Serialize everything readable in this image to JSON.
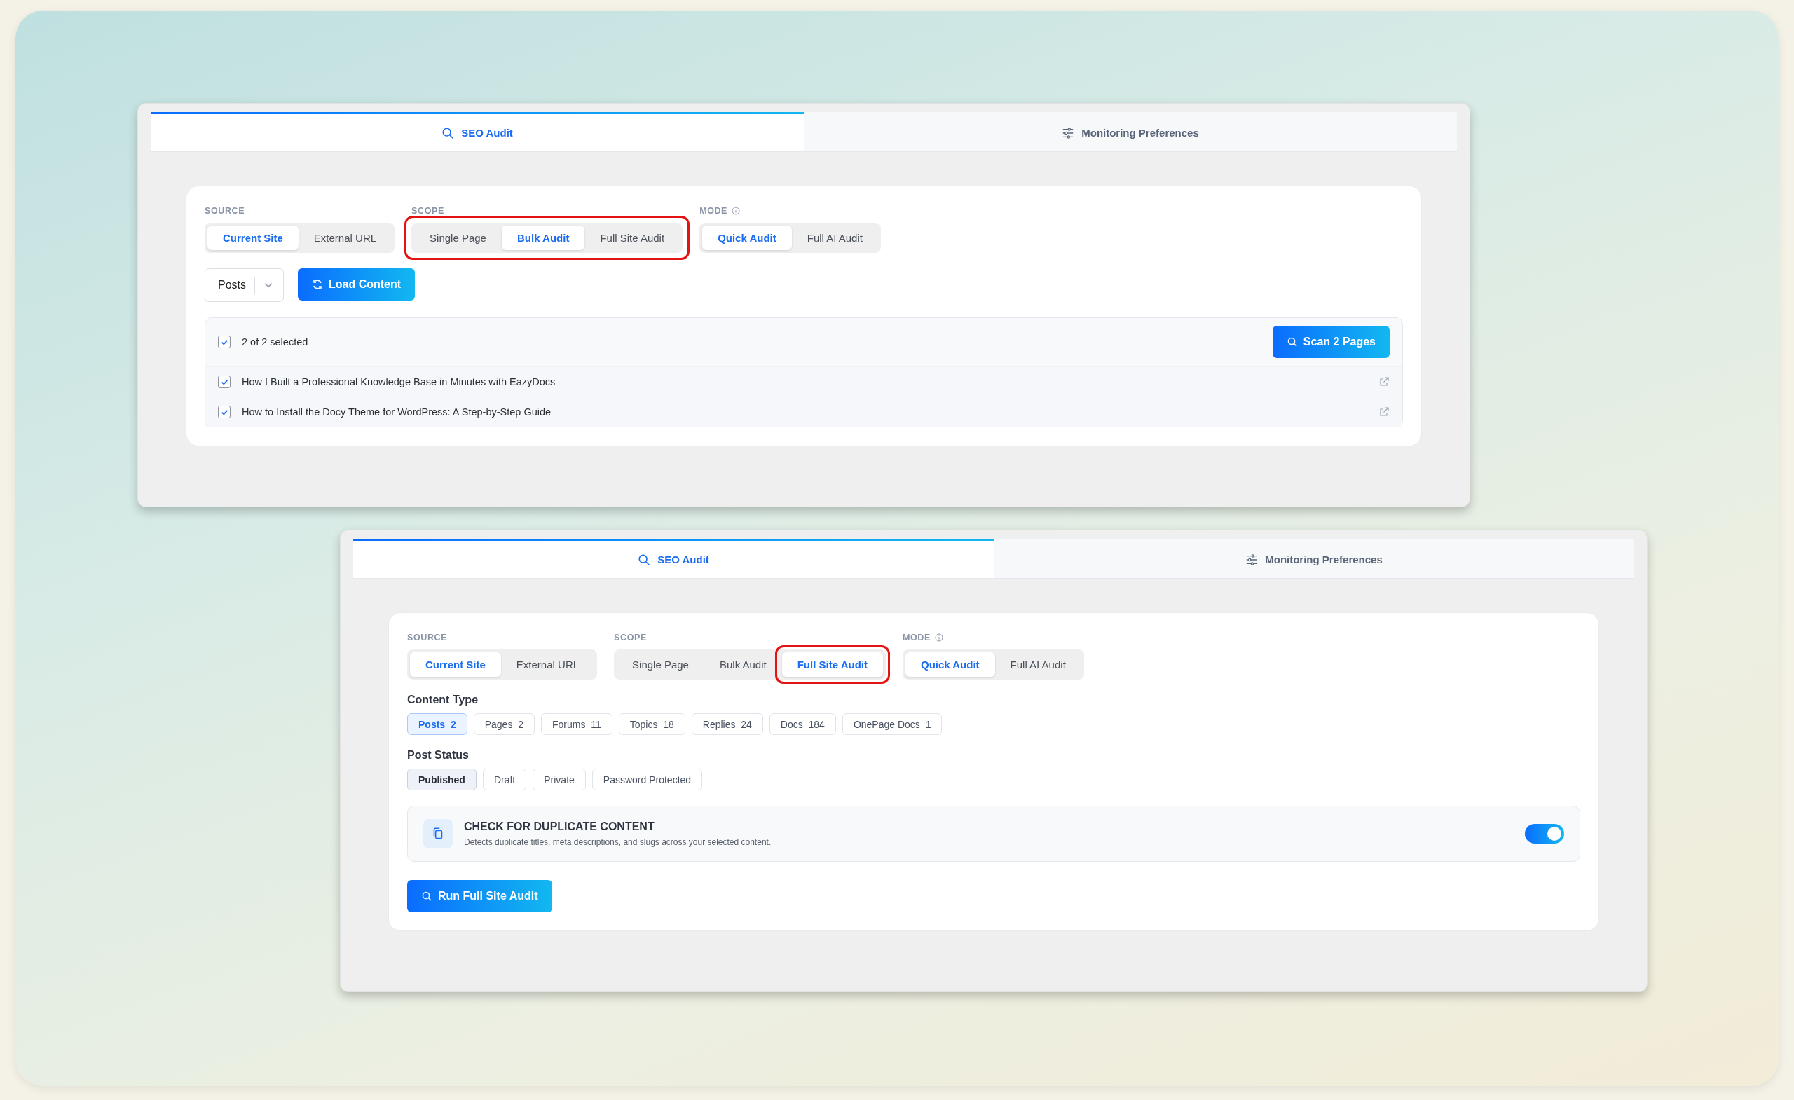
{
  "panels": [
    {
      "tabs": [
        {
          "label": "SEO Audit",
          "selected": true
        },
        {
          "label": "Monitoring Preferences",
          "selected": false
        }
      ],
      "groups": [
        {
          "label": "SOURCE",
          "info": false,
          "highlighted": false,
          "options": [
            {
              "label": "Current Site",
              "selected": true,
              "highlighted": false
            },
            {
              "label": "External URL",
              "selected": false,
              "highlighted": false
            }
          ]
        },
        {
          "label": "SCOPE",
          "info": false,
          "highlighted": true,
          "options": [
            {
              "label": "Single Page",
              "selected": false,
              "highlighted": false
            },
            {
              "label": "Bulk Audit",
              "selected": true,
              "highlighted": false
            },
            {
              "label": "Full Site Audit",
              "selected": false,
              "highlighted": false
            }
          ]
        },
        {
          "label": "MODE",
          "info": true,
          "highlighted": false,
          "options": [
            {
              "label": "Quick Audit",
              "selected": true,
              "highlighted": false
            },
            {
              "label": "Full AI Audit",
              "selected": false,
              "highlighted": false
            }
          ]
        }
      ],
      "blocks": [
        {
          "kind": "loader",
          "select": {
            "value": "Posts"
          },
          "button": "Load Content"
        },
        {
          "kind": "selection",
          "checked": true,
          "summary": "2 of 2 selected",
          "button": "Scan 2 Pages",
          "items": [
            {
              "title": "How I Built a Professional Knowledge Base in Minutes with EazyDocs",
              "checked": true
            },
            {
              "title": "How to Install the Docy Theme for WordPress: A Step-by-Step Guide",
              "checked": true
            }
          ]
        }
      ]
    },
    {
      "tabs": [
        {
          "label": "SEO Audit",
          "selected": true
        },
        {
          "label": "Monitoring Preferences",
          "selected": false
        }
      ],
      "groups": [
        {
          "label": "SOURCE",
          "info": false,
          "highlighted": false,
          "options": [
            {
              "label": "Current Site",
              "selected": true,
              "highlighted": false
            },
            {
              "label": "External URL",
              "selected": false,
              "highlighted": false
            }
          ]
        },
        {
          "label": "SCOPE",
          "info": false,
          "highlighted": false,
          "options": [
            {
              "label": "Single Page",
              "selected": false,
              "highlighted": false
            },
            {
              "label": "Bulk Audit",
              "selected": false,
              "highlighted": false
            },
            {
              "label": "Full Site Audit",
              "selected": true,
              "highlighted": true
            }
          ]
        },
        {
          "label": "MODE",
          "info": true,
          "highlighted": false,
          "options": [
            {
              "label": "Quick Audit",
              "selected": true,
              "highlighted": false
            },
            {
              "label": "Full AI Audit",
              "selected": false,
              "highlighted": false
            }
          ]
        }
      ],
      "blocks": [
        {
          "kind": "type-chips",
          "title": "Content Type",
          "chips": [
            {
              "label": "Posts",
              "count": "2",
              "selected": true
            },
            {
              "label": "Pages",
              "count": "2",
              "selected": false
            },
            {
              "label": "Forums",
              "count": "11",
              "selected": false
            },
            {
              "label": "Topics",
              "count": "18",
              "selected": false
            },
            {
              "label": "Replies",
              "count": "24",
              "selected": false
            },
            {
              "label": "Docs",
              "count": "184",
              "selected": false
            },
            {
              "label": "OnePage Docs",
              "count": "1",
              "selected": false
            }
          ]
        },
        {
          "kind": "status-chips",
          "title": "Post Status",
          "chips": [
            {
              "label": "Published",
              "selected": true
            },
            {
              "label": "Draft",
              "selected": false
            },
            {
              "label": "Private",
              "selected": false
            },
            {
              "label": "Password Protected",
              "selected": false
            }
          ]
        },
        {
          "kind": "toggle",
          "title": "CHECK FOR DUPLICATE CONTENT",
          "description": "Detects duplicate titles, meta descriptions, and slugs across your selected content.",
          "on": true
        },
        {
          "kind": "action",
          "button": "Run Full Site Audit"
        }
      ]
    }
  ]
}
